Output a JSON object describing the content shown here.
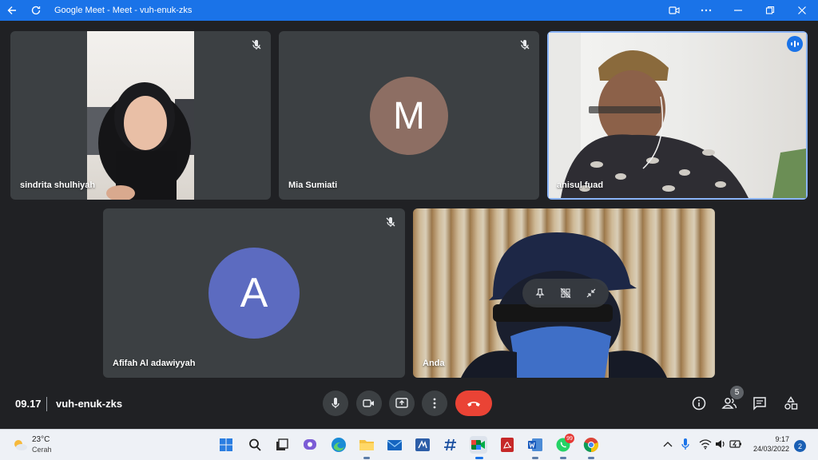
{
  "window": {
    "title": "Google Meet - Meet - vuh-enuk-zks",
    "accent": "#1a73e8"
  },
  "tiles": [
    {
      "name": "sindrita shulhiyah",
      "muted": true,
      "type": "video"
    },
    {
      "name": "Mia Sumiati",
      "muted": true,
      "type": "avatar",
      "avatar_letter": "M",
      "avatar_color": "#8d6e63"
    },
    {
      "name": "anisul fuad",
      "muted": false,
      "type": "video",
      "speaking": true
    },
    {
      "name": "Afifah Al adawiyyah",
      "muted": true,
      "type": "avatar",
      "avatar_letter": "A",
      "avatar_color": "#5c6bc0"
    },
    {
      "name": "Anda",
      "muted": false,
      "type": "video",
      "self": true
    }
  ],
  "meeting": {
    "time": "09.17",
    "code": "vuh-enuk-zks",
    "participant_count": "5",
    "end_call_color": "#ea4335"
  },
  "taskbar": {
    "weather_temp": "23°C",
    "weather_desc": "Cerah",
    "time": "9:17",
    "date": "24/03/2022",
    "notification_count": "2",
    "whatsapp_badge": "99"
  }
}
